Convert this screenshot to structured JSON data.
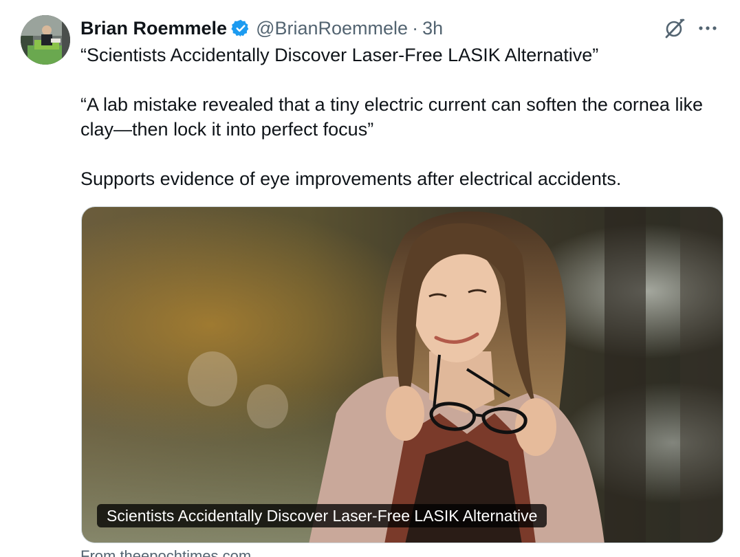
{
  "author": {
    "name": "Brian Roemmele",
    "handle": "@BrianRoemmele",
    "separator": "·",
    "time": "3h",
    "verified_color": "#1d9bf0"
  },
  "icons": {
    "avatar": "profile-photo",
    "verified": "verified-badge-icon",
    "grok": "grok-icon",
    "more": "more-horizontal-icon"
  },
  "tweet": {
    "paragraphs": [
      "“Scientists Accidentally Discover Laser-Free LASIK Alternative”",
      "“A lab mistake revealed that a tiny electric current can soften the cornea like clay—then lock it into perfect focus”",
      "Supports evidence of eye improvements after electrical accidents."
    ]
  },
  "card": {
    "caption": "Scientists Accidentally Discover Laser-Free LASIK Alternative",
    "source": "From theepochtimes.com",
    "image_description_icon": "woman-holding-glasses-photo"
  },
  "colors": {
    "text_primary": "#0f1419",
    "text_secondary": "#536471",
    "border": "#cfd9de"
  }
}
